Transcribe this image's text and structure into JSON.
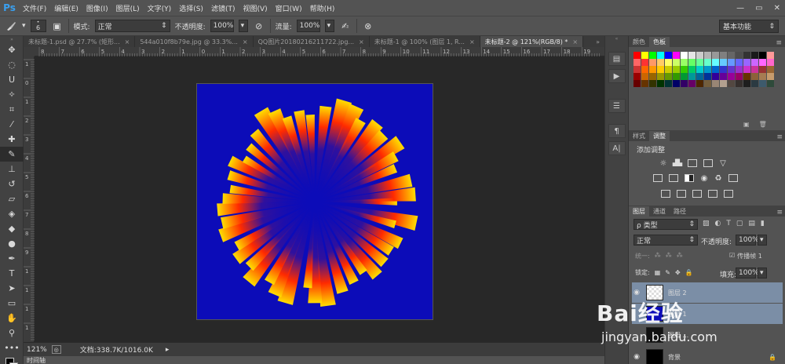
{
  "app": {
    "logo": "Ps"
  },
  "menu": [
    "文件(F)",
    "编辑(E)",
    "图像(I)",
    "图层(L)",
    "文字(Y)",
    "选择(S)",
    "滤镜(T)",
    "视图(V)",
    "窗口(W)",
    "帮助(H)"
  ],
  "window_controls": {
    "minimize": "—",
    "restore": "▭",
    "close": "✕"
  },
  "options": {
    "brush_size": "6",
    "mode_label": "模式:",
    "mode_value": "正常",
    "opacity_label": "不透明度:",
    "opacity_value": "100%",
    "flow_label": "流量:",
    "flow_value": "100%",
    "workspace": "基本功能"
  },
  "tabs": [
    {
      "label": "未标题-1.psd @ 27.7% (矩形...",
      "active": false
    },
    {
      "label": "544a010f8b79e.jpg @ 33.3%...",
      "active": false
    },
    {
      "label": "QQ图片20180216211722.jpg...",
      "active": false
    },
    {
      "label": "未标题-1 @ 100% (图层 1, R...",
      "active": false
    },
    {
      "label": "未标题-2 @ 121%(RGB/8) *",
      "active": true
    }
  ],
  "hruler_labels": [
    "8",
    "7",
    "6",
    "5",
    "4",
    "3",
    "2",
    "1",
    "0",
    "1",
    "2",
    "3",
    "4",
    "5",
    "6",
    "7",
    "8",
    "9",
    "10",
    "11",
    "12",
    "13",
    "14",
    "15",
    "16",
    "17",
    "18",
    "19"
  ],
  "vruler_labels": [
    "1",
    "0",
    "1",
    "2",
    "3",
    "4",
    "5",
    "6",
    "7",
    "8",
    "9",
    "1",
    "1",
    "1",
    "1",
    "1"
  ],
  "status": {
    "zoom": "121%",
    "doc": "文档:338.7K/1016.0K"
  },
  "timeline_label": "时间轴",
  "panels": {
    "color_tabs": [
      "颜色",
      "色板"
    ],
    "adjust_tabs": [
      "样式",
      "调整"
    ],
    "adjust_title": "添加调整",
    "layer_tabs": [
      "图层",
      "通道",
      "路径"
    ],
    "filter_kind": "ρ 类型",
    "blend_mode": "正常",
    "opacity_label": "不透明度:",
    "opacity_value": "100%",
    "unify_label": "统一:",
    "propagate_label": "传播帧 1",
    "lock_label": "锁定:",
    "fill_label": "填充:",
    "fill_value": "100%",
    "layers": [
      {
        "name": "图层 2",
        "selected": true
      },
      {
        "name": "图层 1",
        "selected": true
      },
      {
        "name": "图层 ...",
        "selected": false
      },
      {
        "name": "背景",
        "selected": false
      }
    ]
  },
  "colors": {
    "canvas_bg": "#0c0cb8",
    "burst_inner": "#ff2a00",
    "burst_mid": "#ff8c00",
    "burst_outer": "#ffe000",
    "selected_layer": "#7b8ea6"
  },
  "watermark": {
    "logo": "Bai经验",
    "url": "jingyan.baidu.com"
  }
}
